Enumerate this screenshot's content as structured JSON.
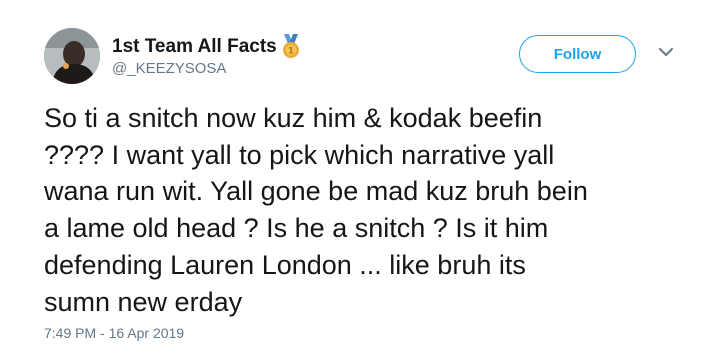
{
  "user": {
    "display_name": "1st Team All Facts",
    "handle": "@_KEEZYSOSA",
    "badge_icon": "medal-icon"
  },
  "actions": {
    "follow_label": "Follow",
    "more_icon": "chevron-down-icon"
  },
  "tweet": {
    "lines": [
      "So ti a snitch now kuz him & kodak beefin",
      "???? I want yall to pick which narrative yall",
      "wana run wit. Yall gone be mad kuz bruh bein",
      "a lame old head ? Is he a snitch ? Is it him",
      "defending Lauren London ... like bruh its",
      "sumn new erday"
    ],
    "timestamp": "7:49 PM - 16 Apr 2019"
  },
  "colors": {
    "accent": "#1da1f2",
    "text": "#14171a",
    "muted": "#657786",
    "medal_gold": "#e8a93a",
    "ribbon_blue": "#5c9bd6"
  }
}
